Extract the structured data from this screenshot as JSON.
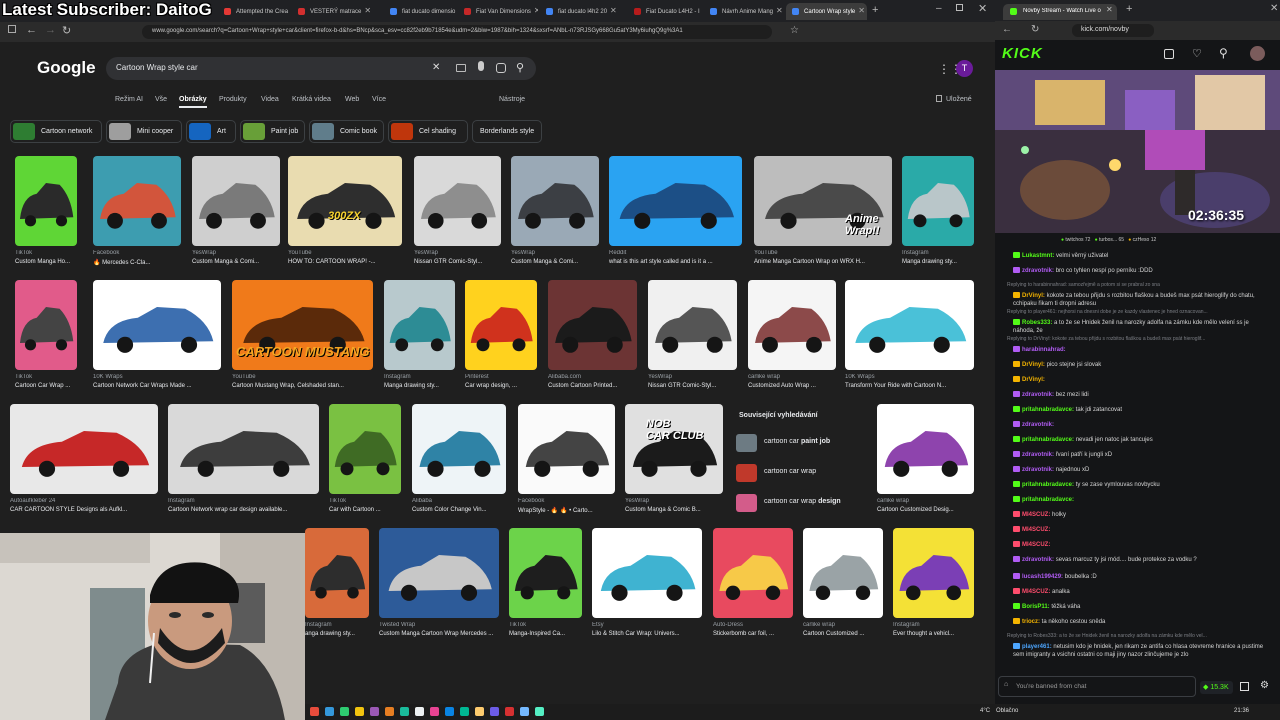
{
  "overlay_title": "Latest Subscriber: DaitoG",
  "left_tabs": [
    {
      "label": "Attempted the Crea",
      "color": "#e53935"
    },
    {
      "label": "VESTERÝ matrace",
      "color": "#d32f2f"
    },
    {
      "label": "fiat ducato dimensio",
      "color": "#4285f4"
    },
    {
      "label": "Fiat Van Dimensions",
      "color": "#c62828"
    },
    {
      "label": "fiat ducato l4h2 20",
      "color": "#4285f4"
    },
    {
      "label": "Fiat Ducato L4H2 - I",
      "color": "#b71c1c"
    },
    {
      "label": "Návrh Anime Mang",
      "color": "#4285f4"
    },
    {
      "label": "Cartoon Wrap style",
      "color": "#4285f4"
    }
  ],
  "url": "www.google.com/search?q=Cartoon+Wrap+style+car&client=firefox-b-d&hs=BNcp&sca_esv=cc82f2eb9b71854e&udm=2&biw=1987&bih=1324&sxsrf=ANbL-n73RJSGy668Gu5atY3My6iuhgQ9g%3A1",
  "google": {
    "logo": "Google",
    "query": "Cartoon Wrap style car",
    "tabs": [
      "Režim AI",
      "Vše",
      "Obrázky",
      "Produkty",
      "Videa",
      "Krátká videa",
      "Web",
      "Více",
      "Nástroje"
    ],
    "saved": "Uložené",
    "chips": [
      {
        "label": "Cartoon network",
        "color": "#2e7d32"
      },
      {
        "label": "Mini cooper",
        "color": "#9e9e9e"
      },
      {
        "label": "Art",
        "color": "#1565c0"
      },
      {
        "label": "Paint job",
        "color": "#689f38"
      },
      {
        "label": "Comic book",
        "color": "#607d8b"
      },
      {
        "label": "Cel shading",
        "color": "#bf360c"
      },
      {
        "label": "Borderlands style",
        "color": ""
      }
    ],
    "results": [
      {
        "src": "TikTok",
        "title": "Custom Manga Ho...",
        "c1": "#5fd636",
        "c2": "#2a2a2a"
      },
      {
        "src": "Facebook",
        "title": "🔥 Mercedes C-Cla...",
        "c1": "#3d9db0",
        "c2": "#d2553c"
      },
      {
        "src": "YesWrap",
        "title": "Custom Manga & Comi...",
        "c1": "#cfcfcf",
        "c2": "#7a7a7a"
      },
      {
        "src": "YouTube",
        "title": "HOW TO: CARTOON WRAP! -...",
        "c1": "#e9dcb0",
        "c2": "#2e2e2e"
      },
      {
        "src": "YesWrap",
        "title": "Nissan GTR Comic-Styl...",
        "c1": "#d9d9d9",
        "c2": "#8e8e8e"
      },
      {
        "src": "YesWrap",
        "title": "Custom Manga & Comi...",
        "c1": "#9aa9b6",
        "c2": "#3c3f44"
      },
      {
        "src": "Reddit",
        "title": "what is this art style called and is it a ...",
        "c1": "#2aa3f2",
        "c2": "#1c4f86"
      },
      {
        "src": "YouTube",
        "title": "Anime Manga Cartoon Wrap on WRX H...",
        "c1": "#bdbdbd",
        "c2": "#4a4a4a"
      },
      {
        "src": "Instagram",
        "title": "Manga drawing sty...",
        "c1": "#2aaaa8",
        "c2": "#b9c6c9"
      },
      {
        "src": "TikTok",
        "title": "Cartoon Car Wrap ...",
        "c1": "#e15b8a",
        "c2": "#444"
      },
      {
        "src": "10K Wraps",
        "title": "Cartoon Network Car Wraps Made ...",
        "c1": "#ffffff",
        "c2": "#3d6fb0"
      },
      {
        "src": "YouTube",
        "title": "Cartoon Mustang Wrap, Celshaded stan...",
        "c1": "#f07a1a",
        "c2": "#5b2a0a"
      },
      {
        "src": "Instagram",
        "title": "Manga drawing sty...",
        "c1": "#b8c9cd",
        "c2": "#2d8c95"
      },
      {
        "src": "Pinterest",
        "title": "Car wrap design, ...",
        "c1": "#ffd21e",
        "c2": "#d0321d"
      },
      {
        "src": "Alibaba.com",
        "title": "Custom Cartoon Printed...",
        "c1": "#6c3434",
        "c2": "#1b1b1b"
      },
      {
        "src": "YesWrap",
        "title": "Nissan GTR Comic-Styl...",
        "c1": "#f0f0f0",
        "c2": "#555"
      },
      {
        "src": "carlike wrap",
        "title": "Customized Auto Wrap ...",
        "c1": "#f5f5f5",
        "c2": "#8c4a4a"
      },
      {
        "src": "10K Wraps",
        "title": "Transform Your Ride with Cartoon N...",
        "c1": "#ffffff",
        "c2": "#4ac1d8"
      },
      {
        "src": "Autoaufkleber 24",
        "title": "CAR CARTOON STYLE Designs als Aufkl...",
        "c1": "#e8e8e8",
        "c2": "#c62828"
      },
      {
        "src": "Instagram",
        "title": "Cartoon Network wrap car design available...",
        "c1": "#d9d9d9",
        "c2": "#3d3d3d"
      },
      {
        "src": "TikTok",
        "title": "Car with Cartoon ...",
        "c1": "#7ac142",
        "c2": "#3f6b24"
      },
      {
        "src": "Alibaba",
        "title": "Custom Color Change Vin...",
        "c1": "#eef4f7",
        "c2": "#2f83a6"
      },
      {
        "src": "Facebook",
        "title": "WrapStyle - 🔥 🔥 • Carto...",
        "c1": "#fafafa",
        "c2": "#444"
      },
      {
        "src": "YesWrap",
        "title": "Custom Manga & Comic B...",
        "c1": "#e0e0e0",
        "c2": "#1b1b1b"
      },
      {
        "src": "carlike wrap",
        "title": "Cartoon Customized Desig...",
        "c1": "#ffffff",
        "c2": "#8e44ad"
      },
      {
        "src": "Instagram",
        "title": "anga drawing sty...",
        "c1": "#d86a3a",
        "c2": "#2d2d2d"
      },
      {
        "src": "Twisted Wrap",
        "title": "Custom Manga Cartoon Wrap Mercedes ...",
        "c1": "#2d5b99",
        "c2": "#c7c7c7"
      },
      {
        "src": "TikTok",
        "title": "Manga-Inspired Ca...",
        "c1": "#6cd34a",
        "c2": "#1e1e1e"
      },
      {
        "src": "Etsy",
        "title": "Lilo & Stitch Car Wrap: Univers...",
        "c1": "#ffffff",
        "c2": "#3fb3d1"
      },
      {
        "src": "Auto-Dress",
        "title": "Stickerbomb car foil, ...",
        "c1": "#e84a5f",
        "c2": "#f7c948"
      },
      {
        "src": "carlike wrap",
        "title": "Cartoon Customized ...",
        "c1": "#ffffff",
        "c2": "#9aa3a6"
      },
      {
        "src": "Instagram",
        "title": "Ever thought a vehicl...",
        "c1": "#f4e136",
        "c2": "#7b3fb5"
      }
    ],
    "overlays": {
      "r1_4": "300ZX",
      "r1_7": "Anime\nWrap!!",
      "r2_3": "CARTOON MUSTANG",
      "r3_6": "NOB\nCAR CLUB"
    },
    "related": {
      "title": "Související vyhledávání",
      "items": [
        {
          "pre": "cartoon car ",
          "bold": "paint job",
          "color": "#6d7b83"
        },
        {
          "pre": "cartoon car wrap",
          "bold": "",
          "color": "#c0392b"
        },
        {
          "pre": "cartoon car wrap ",
          "bold": "design",
          "color": "#d35c8a"
        }
      ]
    }
  },
  "right_tab": {
    "label": "Novby Stream - Watch Live o",
    "color": "#53fc18"
  },
  "right_url": "kick.com/novby",
  "kick": {
    "logo": "KICK",
    "timer": "02:36:35",
    "top_line": "Lukastmnt: velmi věrný uživatel",
    "gifters": [
      {
        "name": "twitchos",
        "count": "72"
      },
      {
        "name": "turbos...",
        "count": "65"
      },
      {
        "name": "czHeso",
        "count": "12"
      }
    ],
    "messages": [
      {
        "t": "msg",
        "user": "Lukastmnt:",
        "text": "velmi věrný uživatel",
        "uc": "#53fc18"
      },
      {
        "t": "msg",
        "user": "zdravotnik:",
        "text": "bro co tyhlen nespí po perníku :DDD",
        "uc": "#b15cf4"
      },
      {
        "t": "reply",
        "text": "Replying to harabinnahrad: samozřejmě a potom si se prabral zo sna"
      },
      {
        "t": "msg",
        "user": "DrVinyl:",
        "text": "kokote za tebou přijdu s rozbitou flaškou a budeš max psát hieroglify do chatu, cchipaku řikam ti dropni adresu",
        "uc": "#f4b400"
      },
      {
        "t": "reply",
        "text": "Replying to player461: nejhorsi na dnesni dobe je ze kazdy vlastenec je hned oznacovan..."
      },
      {
        "t": "msg",
        "user": "Robes333:",
        "text": "a to že se Hnidek ženil na narozky adolfa na zámku kde mělo velení ss je náhoda, že",
        "uc": "#53fc18"
      },
      {
        "t": "reply",
        "text": "Replying to DrVinyl: kokote za tebou přijdu s rozbitou flaškou a budeš max psát hieroglif..."
      },
      {
        "t": "msg",
        "user": "harabinnahrad:",
        "text": "",
        "uc": "#b15cf4"
      },
      {
        "t": "msg",
        "user": "DrVinyl:",
        "text": "pico stejne jsi slovak",
        "uc": "#f4b400"
      },
      {
        "t": "msg",
        "user": "DrVinyl:",
        "text": "",
        "uc": "#f4b400"
      },
      {
        "t": "msg",
        "user": "zdravotnik:",
        "text": "bez mezi lidi",
        "uc": "#b15cf4"
      },
      {
        "t": "msg",
        "user": "pritahnabradavce:",
        "text": "tak jdi zatancovat",
        "uc": "#53fc18"
      },
      {
        "t": "msg",
        "user": "zdravotnik:",
        "text": "",
        "uc": "#b15cf4"
      },
      {
        "t": "msg",
        "user": "pritahnabradavce:",
        "text": "nevadi jen natoc jak tancujes",
        "uc": "#53fc18"
      },
      {
        "t": "msg",
        "user": "zdravotnik:",
        "text": "řvaní patří k jungli xD",
        "uc": "#b15cf4"
      },
      {
        "t": "msg",
        "user": "zdravotnik:",
        "text": "najednou xD",
        "uc": "#b15cf4"
      },
      {
        "t": "msg",
        "user": "pritahnabradavce:",
        "text": "ty se zase vymlouvas novbycku",
        "uc": "#53fc18"
      },
      {
        "t": "msg",
        "user": "pritahnabradavce:",
        "text": "",
        "uc": "#53fc18"
      },
      {
        "t": "msg",
        "user": "MI4SCUZ:",
        "text": "holky",
        "uc": "#ff4d6d"
      },
      {
        "t": "msg",
        "user": "MI4SCUZ:",
        "text": "",
        "uc": "#ff4d6d"
      },
      {
        "t": "msg",
        "user": "MI4SCUZ:",
        "text": "",
        "uc": "#ff4d6d"
      },
      {
        "t": "msg",
        "user": "zdravotnik:",
        "text": "sevas marcuz ty jsi mód.... bude protekce za vodku ?",
        "uc": "#b15cf4"
      },
      {
        "t": "msg",
        "user": "lucash199429:",
        "text": "boubelka :D",
        "uc": "#b15cf4"
      },
      {
        "t": "msg",
        "user": "MI4SCUZ:",
        "text": "analka",
        "uc": "#ff4d6d"
      },
      {
        "t": "msg",
        "user": "BorisP11:",
        "text": "těžká váha",
        "uc": "#53fc18"
      },
      {
        "t": "msg",
        "user": "triocz:",
        "text": "ta někoho cestou sněda",
        "uc": "#f4b400"
      },
      {
        "t": "reply",
        "text": "Replying to Robes333: a to že se Hnidek ženil na narozky adolfa na zámku kde mělo vel..."
      },
      {
        "t": "msg",
        "user": "player461:",
        "text": "netusim kdo je hnidek, jen rikam ze antifa co hlasa otevreme hranice a pustime sem imigranty a vsichni ostatni co maji jiny nazor zlinčujeme je zlo",
        "uc": "#4da6ff"
      }
    ],
    "chat_placeholder": "You're banned from chat",
    "kicks": "15.3K"
  },
  "taskbar": {
    "weather": "4°C",
    "weather_label": "Oblačno",
    "time": "21:36"
  },
  "webcam_label": "Streamer webcam"
}
